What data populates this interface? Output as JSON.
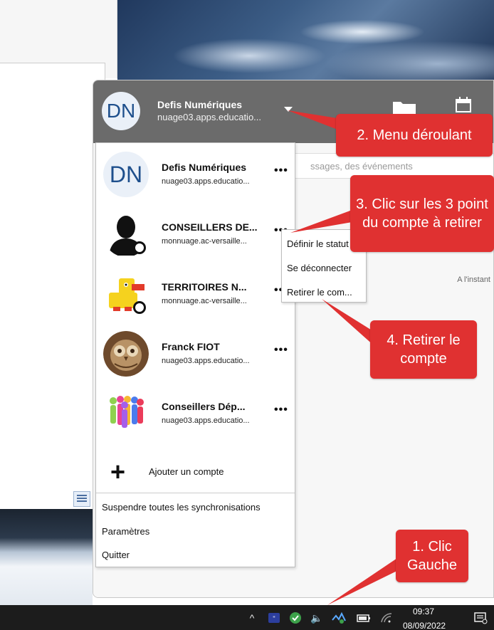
{
  "header": {
    "avatar_initials": "DN",
    "account_name": "Defis Numériques",
    "account_server": "nuage03.apps.educatio..."
  },
  "search": {
    "placeholder": "ssages, des événements"
  },
  "activity": {
    "time_label": "A l'instant"
  },
  "accounts": [
    {
      "name": "Defis Numériques",
      "server": "nuage03.apps.educatio...",
      "avatar": "DN",
      "dots": "•••"
    },
    {
      "name": "CONSEILLERS DE...",
      "server": "monnuage.ac-versaille...",
      "avatar": "person-silhouette",
      "dots": "•••"
    },
    {
      "name": "TERRITOIRES N...",
      "server": "monnuage.ac-versaille...",
      "avatar": "lego-duck",
      "dots": "•••"
    },
    {
      "name": "Franck FIOT",
      "server": "nuage03.apps.educatio...",
      "avatar": "owl-photo",
      "dots": "•••"
    },
    {
      "name": "Conseillers Dép...",
      "server": "nuage03.apps.educatio...",
      "avatar": "colorful-people",
      "dots": "•••"
    }
  ],
  "add_account": {
    "icon": "+",
    "label": "Ajouter un compte"
  },
  "menu_items": {
    "suspend": "Suspendre toutes les synchronisations",
    "settings": "Paramètres",
    "quit": "Quitter"
  },
  "submenu": {
    "set_status": "Définir le statut",
    "logout": "Se déconnecter",
    "remove": "Retirer le com..."
  },
  "taskbar": {
    "time": "09:37",
    "date": "08/09/2022",
    "chevron": "^",
    "volume_icon": "🔈"
  },
  "callouts": {
    "step1": "1. Clic Gauche",
    "step2": "2. Menu déroulant",
    "step3": "3. Clic sur les 3 point du compte à retirer",
    "step4": "4. Retirer le compte"
  },
  "colors": {
    "callout": "#e03131",
    "header": "#6b6b6b",
    "taskbar": "#1c1c1c"
  }
}
